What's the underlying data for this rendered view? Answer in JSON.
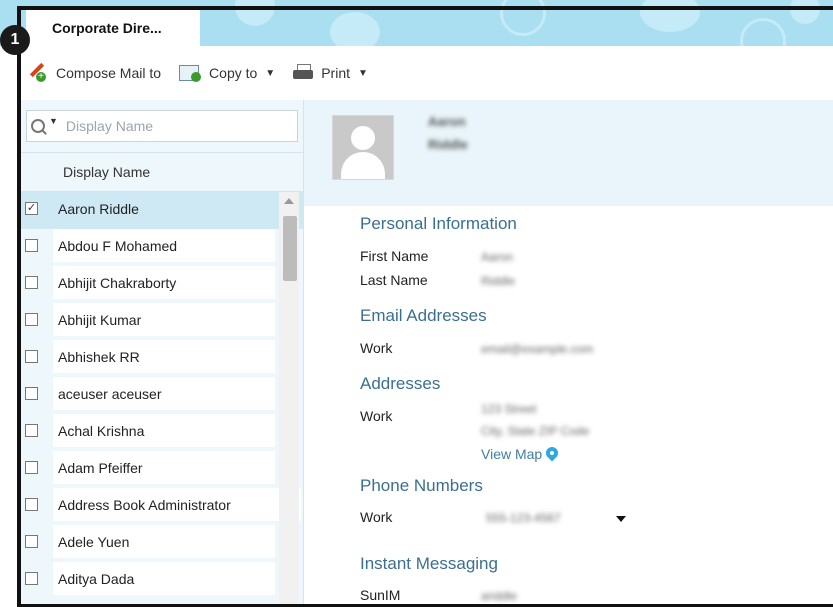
{
  "callout_number": "1",
  "tab": {
    "label": "Corporate Dire..."
  },
  "toolbar": {
    "compose_label": "Compose Mail to",
    "copy_label": "Copy to",
    "print_label": "Print"
  },
  "search": {
    "placeholder": "Display Name",
    "value": ""
  },
  "list": {
    "column_header": "Display Name",
    "rows": [
      {
        "name": "Aaron Riddle",
        "checked": true
      },
      {
        "name": "Abdou F Mohamed",
        "checked": false
      },
      {
        "name": "Abhijit Chakraborty",
        "checked": false
      },
      {
        "name": "Abhijit Kumar",
        "checked": false
      },
      {
        "name": "Abhishek RR",
        "checked": false
      },
      {
        "name": "aceuser aceuser",
        "checked": false
      },
      {
        "name": "Achal Krishna",
        "checked": false
      },
      {
        "name": "Adam Pfeiffer",
        "checked": false
      },
      {
        "name": "Address Book Administrator",
        "checked": false
      },
      {
        "name": "Adele Yuen",
        "checked": false
      },
      {
        "name": "Aditya Dada",
        "checked": false
      }
    ]
  },
  "contact": {
    "first": "Aaron",
    "last": "Riddle",
    "personal_info": {
      "title": "Personal Information",
      "first_name_label": "First Name",
      "first_name_value": "Aaron",
      "last_name_label": "Last Name",
      "last_name_value": "Riddle"
    },
    "email": {
      "title": "Email Addresses",
      "work_label": "Work",
      "work_value": "email@example.com"
    },
    "addresses": {
      "title": "Addresses",
      "work_label": "Work",
      "line1": "123 Street",
      "line2": "City, State ZIP Code",
      "view_map": "View Map"
    },
    "phones": {
      "title": "Phone Numbers",
      "work_label": "Work",
      "work_value": "555-123-4567"
    },
    "im": {
      "title": "Instant Messaging",
      "sunim_label": "SunIM",
      "sunim_value": "ariddle"
    }
  }
}
